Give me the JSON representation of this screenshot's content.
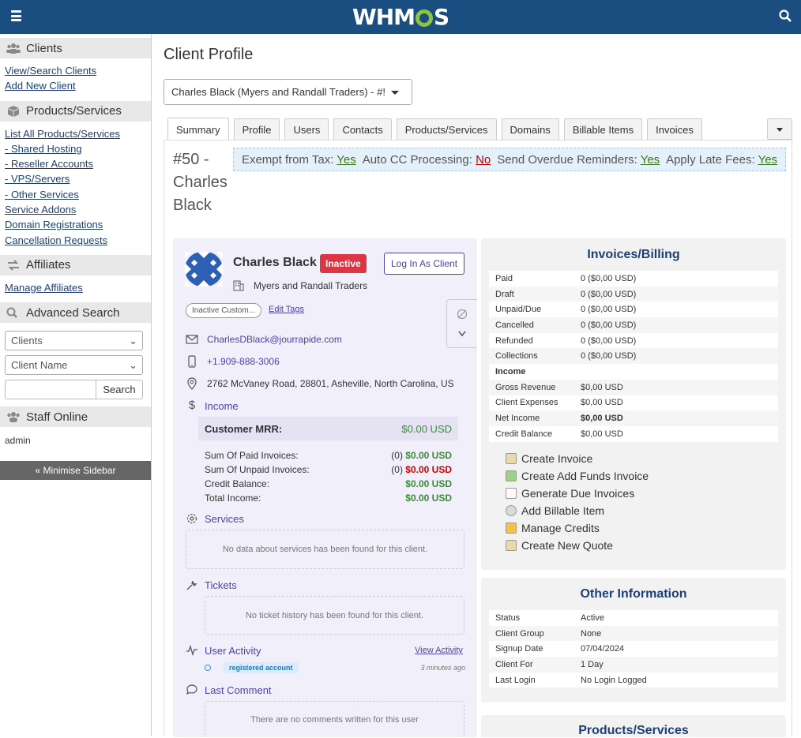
{
  "header": {
    "logo_text": "WHMCS"
  },
  "sidebar": {
    "clients": {
      "title": "Clients",
      "links": [
        "View/Search Clients",
        "Add New Client"
      ]
    },
    "products": {
      "title": "Products/Services",
      "links": [
        "List All Products/Services",
        "- Shared Hosting",
        "- Reseller Accounts",
        "- VPS/Servers",
        "- Other Services",
        "Service Addons",
        "Domain Registrations",
        "Cancellation Requests"
      ]
    },
    "affiliates": {
      "title": "Affiliates",
      "links": [
        "Manage Affiliates"
      ]
    },
    "advanced_search": {
      "title": "Advanced Search",
      "select1": "Clients",
      "select2": "Client Name",
      "search_button": "Search"
    },
    "staff_online": {
      "title": "Staff Online",
      "user": "admin"
    },
    "minimise": "« Minimise Sidebar"
  },
  "page": {
    "title": "Client Profile",
    "client_select": "Charles Black (Myers and Randall Traders) - #!",
    "tabs": [
      "Summary",
      "Profile",
      "Users",
      "Contacts",
      "Products/Services",
      "Domains",
      "Billable Items",
      "Invoices"
    ],
    "client_id_lines": [
      "#50 -",
      "Charles",
      "Black"
    ]
  },
  "flags": {
    "tax_label": "Exempt from Tax:",
    "tax_val": "Yes",
    "cc_label": "Auto CC Processing:",
    "cc_val": "No",
    "overdue_label": "Send Overdue Reminders:",
    "overdue_val": "Yes",
    "late_label": "Apply Late Fees:",
    "late_val": "Yes"
  },
  "profile": {
    "name": "Charles Black",
    "status": "Inactive",
    "login_button": "Log In As Client",
    "company": "Myers and Randall Traders",
    "tag": "Inactive Custom...",
    "edit_tags": "Edit Tags",
    "email": "CharlesDBlack@jourrapide.com",
    "phone": "+1.909-888-3006",
    "address": "2762 McVaney Road, 28801, Asheville, North Carolina, US",
    "income_title": "Income",
    "mrr_label": "Customer MRR:",
    "mrr_value": "$0.00 USD",
    "income_rows": [
      {
        "label": "Sum Of Paid Invoices:",
        "count": "(0)",
        "value": "$0.00 USD",
        "tone": "g"
      },
      {
        "label": "Sum Of Unpaid Invoices:",
        "count": "(0)",
        "value": "$0.00 USD",
        "tone": "r"
      },
      {
        "label": "Credit Balance:",
        "count": "",
        "value": "$0.00 USD",
        "tone": "g"
      },
      {
        "label": "Total Income:",
        "count": "",
        "value": "$0.00 USD",
        "tone": "g"
      }
    ],
    "services_title": "Services",
    "services_empty": "No data about services has been found for this client.",
    "tickets_title": "Tickets",
    "tickets_empty": "No ticket history has been found for this client.",
    "activity_title": "User Activity",
    "view_activity": "View Activity",
    "activity_event": "registered account",
    "activity_time": "3 minutes ago",
    "comment_title": "Last Comment",
    "comment_empty": "There are no comments written for this user"
  },
  "billing": {
    "title": "Invoices/Billing",
    "rows": [
      {
        "k": "Paid",
        "v": "0 ($0,00 USD)"
      },
      {
        "k": "Draft",
        "v": "0 ($0,00 USD)"
      },
      {
        "k": "Unpaid/Due",
        "v": "0 ($0,00 USD)"
      },
      {
        "k": "Cancelled",
        "v": "0 ($0,00 USD)"
      },
      {
        "k": "Refunded",
        "v": "0 ($0,00 USD)"
      },
      {
        "k": "Collections",
        "v": "0 ($0,00 USD)"
      },
      {
        "k": "Income",
        "v": ""
      },
      {
        "k": "Gross Revenue",
        "v": "$0,00 USD"
      },
      {
        "k": "Client Expenses",
        "v": "$0,00 USD"
      },
      {
        "k": "Net Income",
        "v": "$0,00 USD"
      },
      {
        "k": "Credit Balance",
        "v": "$0,00 USD"
      }
    ],
    "actions": [
      "Create Invoice",
      "Create Add Funds Invoice",
      "Generate Due Invoices",
      "Add Billable Item",
      "Manage Credits",
      "Create New Quote"
    ]
  },
  "other_info": {
    "title": "Other Information",
    "rows": [
      {
        "k": "Status",
        "v": "Active"
      },
      {
        "k": "Client Group",
        "v": "None"
      },
      {
        "k": "Signup Date",
        "v": "07/04/2024"
      },
      {
        "k": "Client For",
        "v": "1 Day"
      },
      {
        "k": "Last Login",
        "v": "No Login Logged"
      }
    ]
  },
  "products_box": {
    "title": "Products/Services"
  }
}
